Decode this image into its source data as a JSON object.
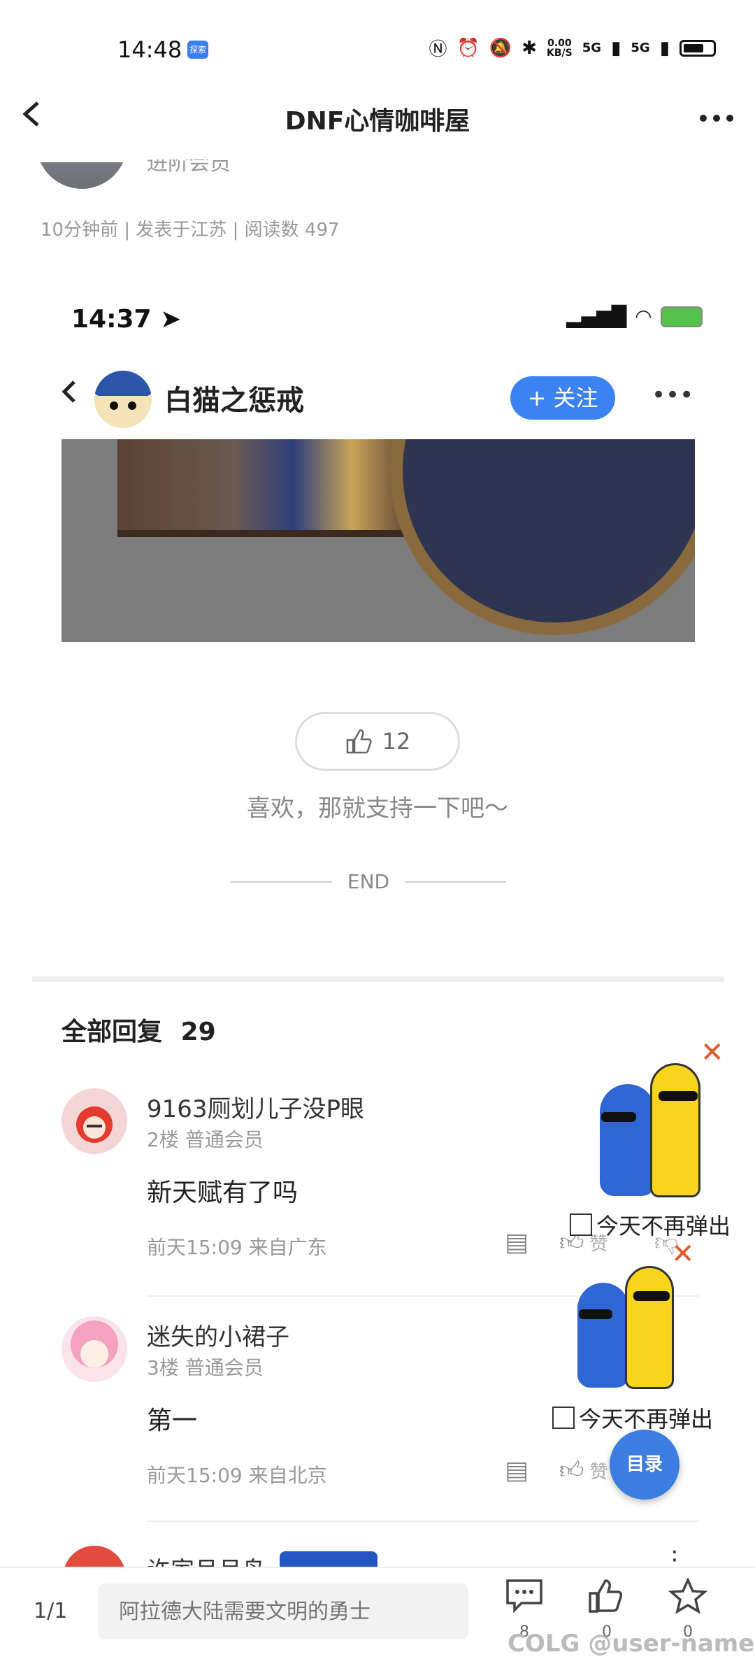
{
  "status_bar": {
    "time": "14:48",
    "app_badge": "探索",
    "net_speed": "0.00\nKB/S",
    "signal_1": "5G",
    "signal_2": "5G"
  },
  "header": {
    "title": "DNF心情咖啡屋",
    "back_icon": "back-arrow-icon",
    "more_icon": "more-dots-icon"
  },
  "post": {
    "member_partial": "进阶会员",
    "meta": "10分钟前 | 发表于江苏 | 阅读数 497"
  },
  "embedded_screenshot": {
    "time": "14:37",
    "author_name": "白猫之惩戒",
    "follow_label": "+ 关注",
    "like_count": "12",
    "support_text": "喜欢，那就支持一下吧～",
    "end_text": "END"
  },
  "comments": {
    "title": "全部回复",
    "count": "29",
    "items": [
      {
        "name": "9163厕划儿子没P眼",
        "level": "2楼 普通会员",
        "body": "新天赋有了吗",
        "meta": "前天15:09 来自广东",
        "like_label": "赞"
      },
      {
        "name": "迷失的小裙子",
        "level": "3楼 普通会员",
        "body": "第一",
        "meta": "前天15:09 来自北京",
        "like_label": "赞"
      }
    ],
    "next_partial_name": "许家月月鸟"
  },
  "popup": {
    "dont_show_today": "今天不再弹出",
    "dont_show_today_2": "今天不再弹出",
    "toc_label": "目录"
  },
  "bottom_bar": {
    "page": "1/1",
    "input_placeholder": "阿拉德大陆需要文明的勇士",
    "comment_count": "8",
    "like_count": "0",
    "favorite_count": "0"
  },
  "watermark": "COLG @user-name",
  "colors": {
    "accent_blue": "#3c82f3",
    "close_orange": "#e05a2b"
  }
}
